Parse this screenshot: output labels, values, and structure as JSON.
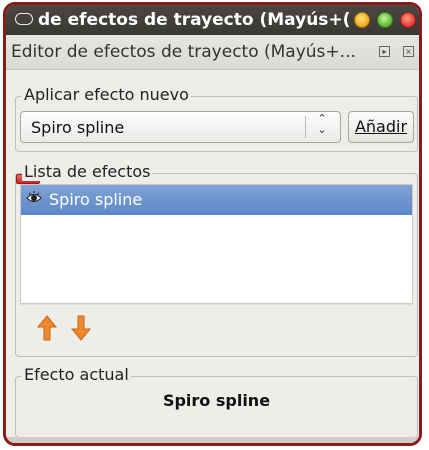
{
  "window": {
    "title": "de efectos de trayecto (Mayús+(",
    "accent": "#8b1a1a"
  },
  "dock": {
    "title": "Editor de efectos de trayecto (Mayús+...",
    "icons": [
      "panel-float-icon",
      "panel-close-icon"
    ]
  },
  "apply_group": {
    "label": "Aplicar efecto nuevo",
    "combo_value": "Spiro spline",
    "add_button_label": "Añadir"
  },
  "list_group": {
    "label": "Lista de efectos",
    "items": [
      {
        "label": "Spiro spline",
        "visible_icon": "eye-icon",
        "selected": true
      }
    ],
    "actions": [
      "move-up-icon",
      "move-down-icon",
      "remove-icon"
    ],
    "colors": {
      "selection": "#5d87c6",
      "up_down": "#f0882c",
      "remove": "#d9342b"
    }
  },
  "current_group": {
    "label": "Efecto actual",
    "value": "Spiro spline"
  }
}
